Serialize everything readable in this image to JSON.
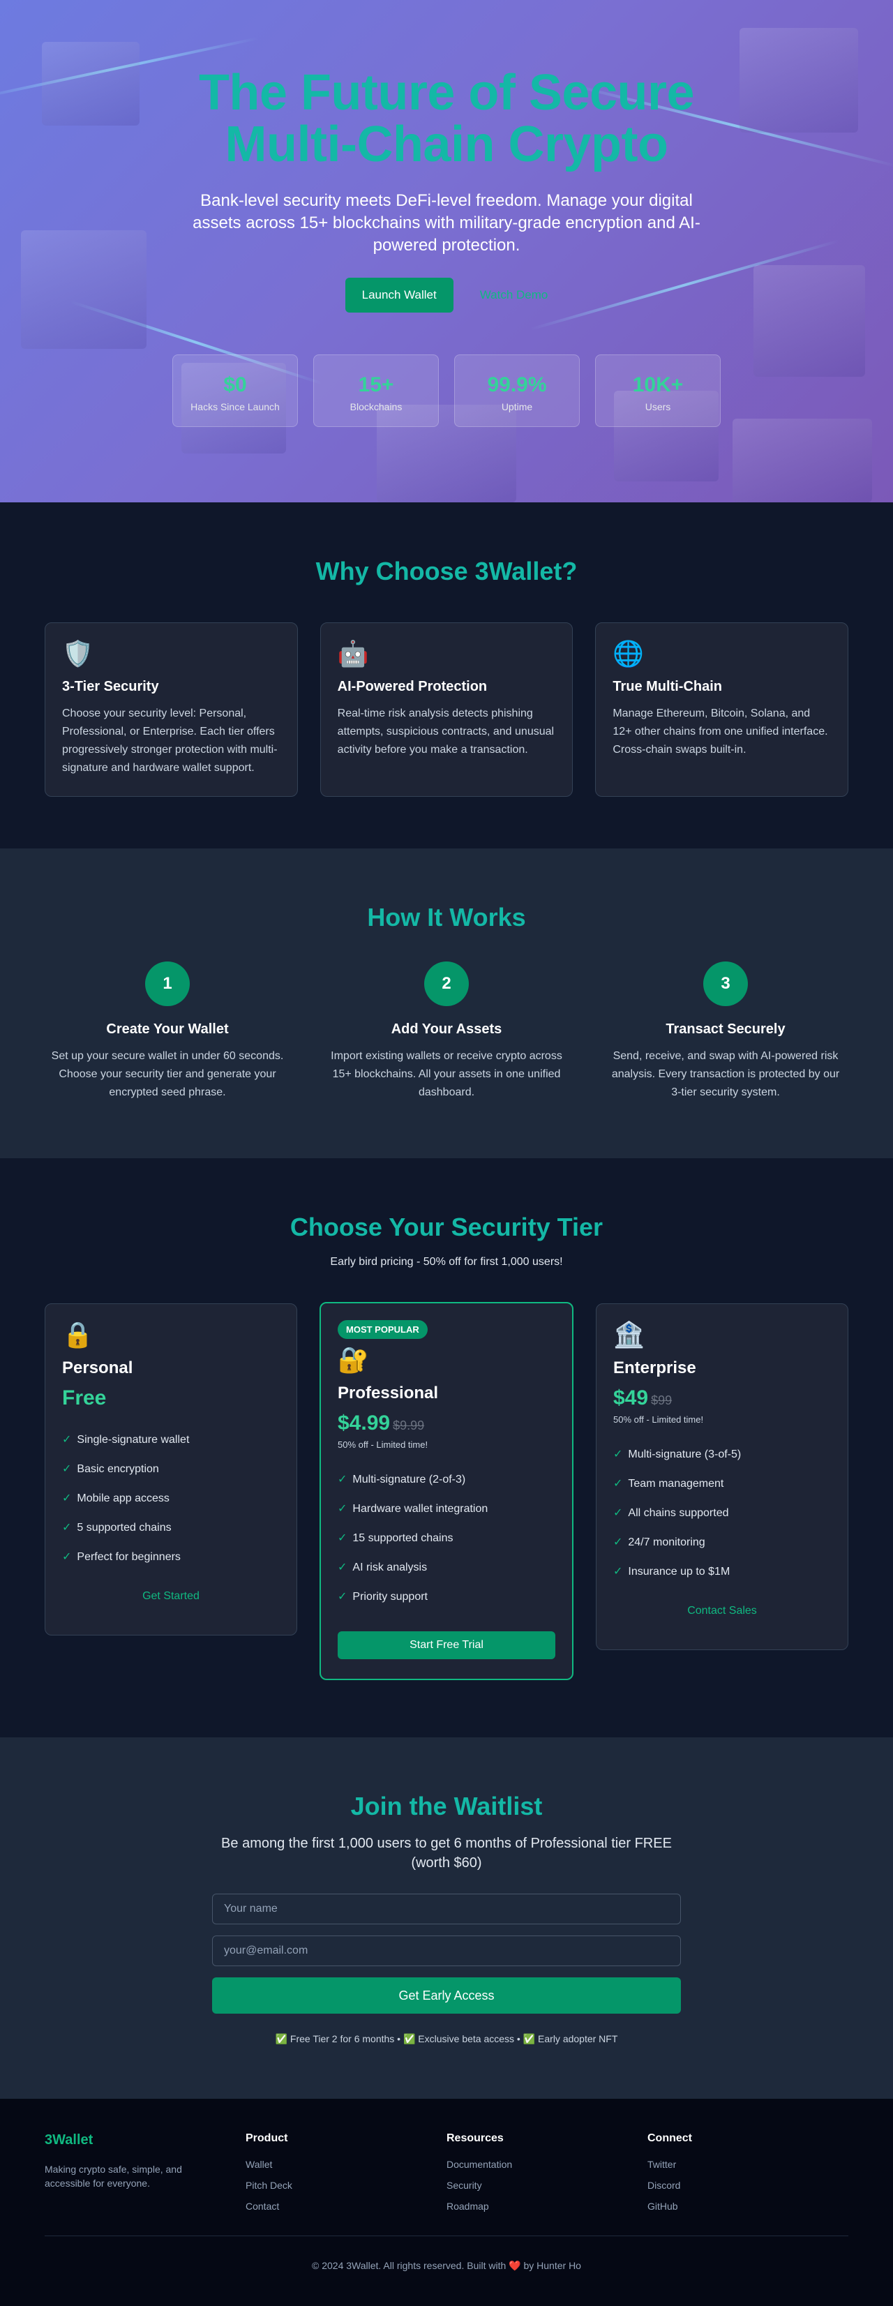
{
  "hero": {
    "title_line1": "The Future of Secure",
    "title_line2": "Multi-Chain Crypto",
    "subtitle": "Bank-level security meets DeFi-level freedom. Manage your digital assets across 15+ blockchains with military-grade encryption and AI-powered protection.",
    "primary_cta": "Launch Wallet",
    "secondary_cta": "Watch Demo",
    "stats": [
      {
        "value": "$0",
        "label": "Hacks Since Launch"
      },
      {
        "value": "15+",
        "label": "Blockchains"
      },
      {
        "value": "99.9%",
        "label": "Uptime"
      },
      {
        "value": "10K+",
        "label": "Users"
      }
    ]
  },
  "why": {
    "title": "Why Choose 3Wallet?",
    "features": [
      {
        "icon": "shield-icon",
        "glyph": "🛡️",
        "title": "3-Tier Security",
        "text": "Choose your security level: Personal, Professional, or Enterprise. Each tier offers progressively stronger protection with multi-signature and hardware wallet support."
      },
      {
        "icon": "robot-icon",
        "glyph": "🤖",
        "title": "AI-Powered Protection",
        "text": "Real-time risk analysis detects phishing attempts, suspicious contracts, and unusual activity before you make a transaction."
      },
      {
        "icon": "globe-icon",
        "glyph": "🌐",
        "title": "True Multi-Chain",
        "text": "Manage Ethereum, Bitcoin, Solana, and 12+ other chains from one unified interface. Cross-chain swaps built-in."
      }
    ]
  },
  "how": {
    "title": "How It Works",
    "steps": [
      {
        "num": "1",
        "title": "Create Your Wallet",
        "text": "Set up your secure wallet in under 60 seconds. Choose your security tier and generate your encrypted seed phrase."
      },
      {
        "num": "2",
        "title": "Add Your Assets",
        "text": "Import existing wallets or receive crypto across 15+ blockchains. All your assets in one unified dashboard."
      },
      {
        "num": "3",
        "title": "Transact Securely",
        "text": "Send, receive, and swap with AI-powered risk analysis. Every transaction is protected by our 3-tier security system."
      }
    ]
  },
  "pricing": {
    "title": "Choose Your Security Tier",
    "note": "Early bird pricing - 50% off for first 1,000 users!",
    "plans": [
      {
        "glyph": "🔒",
        "name": "Personal",
        "price": "Free",
        "old_price": "",
        "discount": "",
        "badge": "",
        "features": [
          "Single-signature wallet",
          "Basic encryption",
          "Mobile app access",
          "5 supported chains",
          "Perfect for beginners"
        ],
        "cta": "Get Started"
      },
      {
        "glyph": "🔐",
        "name": "Professional",
        "price": "$4.99",
        "old_price": "$9.99",
        "discount": "50% off - Limited time!",
        "badge": "MOST POPULAR",
        "features": [
          "Multi-signature (2-of-3)",
          "Hardware wallet integration",
          "15 supported chains",
          "AI risk analysis",
          "Priority support"
        ],
        "cta": "Start Free Trial"
      },
      {
        "glyph": "🏦",
        "name": "Enterprise",
        "price": "$49",
        "old_price": "$99",
        "discount": "50% off - Limited time!",
        "badge": "",
        "features": [
          "Multi-signature (3-of-5)",
          "Team management",
          "All chains supported",
          "24/7 monitoring",
          "Insurance up to $1M"
        ],
        "cta": "Contact Sales"
      }
    ],
    "check_glyph": "✓"
  },
  "waitlist": {
    "title": "Join the Waitlist",
    "lead": "Be among the first 1,000 users to get 6 months of Professional tier FREE (worth $60)",
    "name_placeholder": "Your name",
    "email_placeholder": "your@email.com",
    "submit": "Get Early Access",
    "perks": "✅ Free Tier 2 for 6 months • ✅ Exclusive beta access • ✅ Early adopter NFT"
  },
  "footer": {
    "brand": "3Wallet",
    "tagline": "Making crypto safe, simple, and accessible for everyone.",
    "columns": [
      {
        "title": "Product",
        "links": [
          "Wallet",
          "Pitch Deck",
          "Contact"
        ]
      },
      {
        "title": "Resources",
        "links": [
          "Documentation",
          "Security",
          "Roadmap"
        ]
      },
      {
        "title": "Connect",
        "links": [
          "Twitter",
          "Discord",
          "GitHub"
        ]
      }
    ],
    "copyright_pre": "© 2024 3Wallet. All rights reserved. Built with",
    "heart": "❤️",
    "copyright_post": "by Hunter Ho"
  }
}
